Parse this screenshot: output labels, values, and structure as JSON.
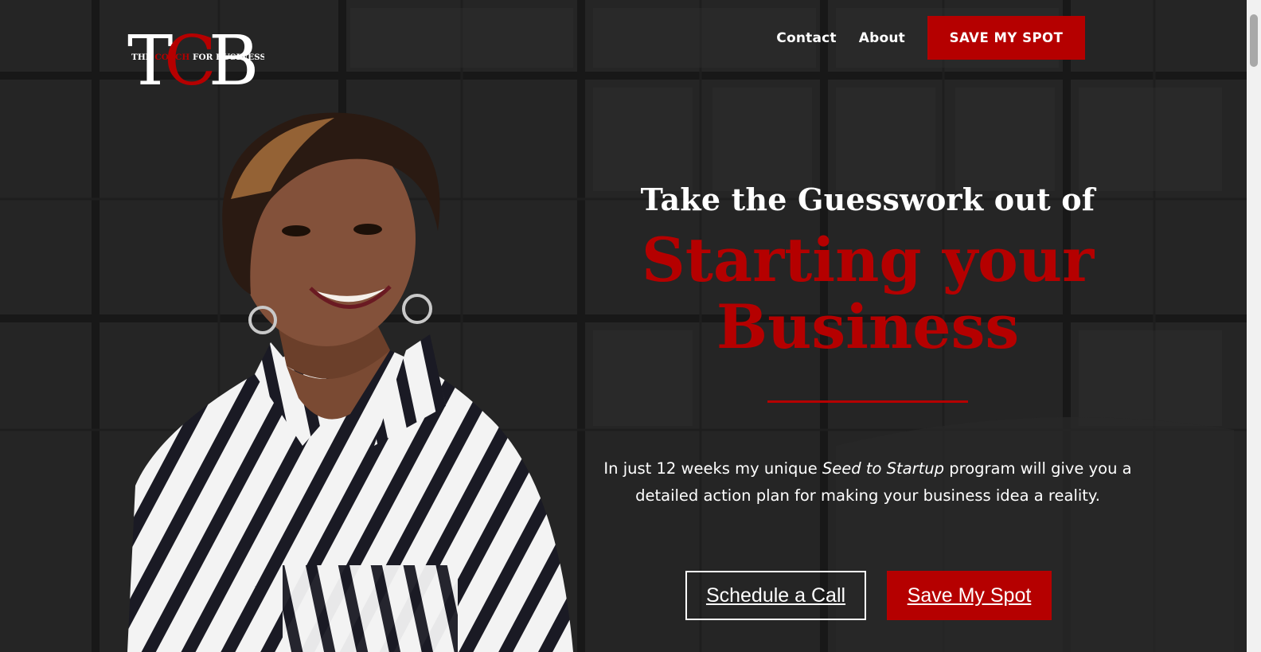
{
  "header": {
    "logo": {
      "letters": "TCB",
      "tagline_prefix": "THE",
      "tagline_accent": "COACH",
      "tagline_suffix": "FOR BUSINESS"
    },
    "nav": [
      {
        "label": "Contact"
      },
      {
        "label": "About"
      }
    ],
    "cta_label": "SAVE MY SPOT"
  },
  "hero": {
    "headline_small": "Take the Guesswork out of",
    "headline_big_line1": "Starting your",
    "headline_big_line2": "Business",
    "body_before": "In just 12 weeks my unique ",
    "body_emphasis": "Seed to Startup",
    "body_after_line1": " program will give you a",
    "body_line2": "detailed action plan for making your business idea a reality.",
    "btn_schedule": "Schedule a Call",
    "btn_save": "Save My Spot"
  },
  "colors": {
    "accent": "#b50000",
    "background": "#2a2a2a",
    "text": "#ffffff"
  },
  "icons": [
    "scrollbar-thumb"
  ]
}
